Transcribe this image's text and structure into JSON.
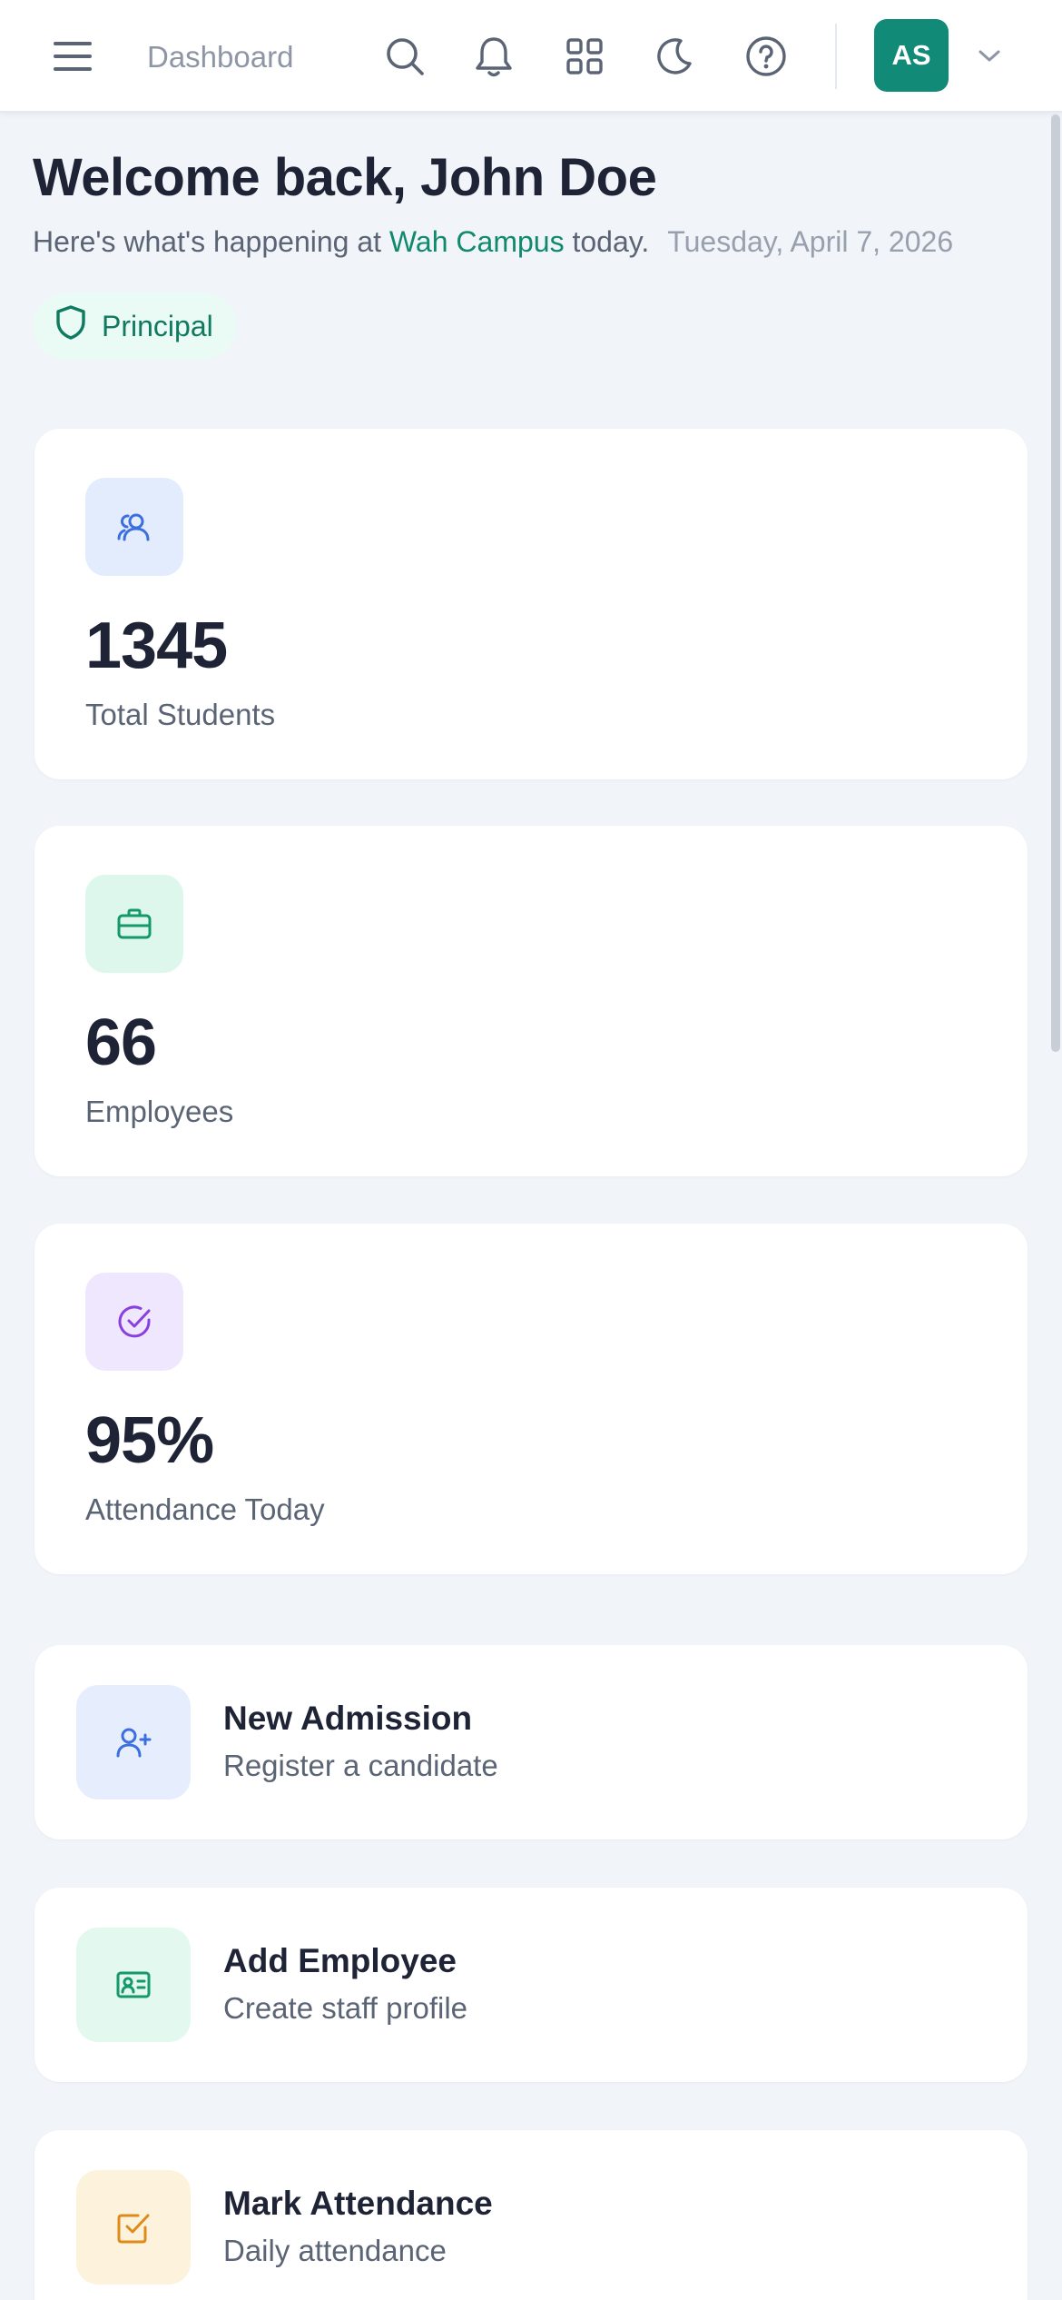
{
  "topbar": {
    "breadcrumb": "Dashboard",
    "avatar_initials": "AS",
    "icons": [
      "menu-icon",
      "search-icon",
      "bell-icon",
      "grid-icon",
      "moon-icon",
      "help-icon",
      "chevron-down-icon"
    ]
  },
  "header": {
    "welcome": "Welcome back, John Doe",
    "sub_prefix": "Here's what's happening at ",
    "campus": "Wah Campus",
    "sub_suffix": " today.",
    "date": "Tuesday, April 7, 2026",
    "role": "Principal"
  },
  "stats": [
    {
      "value": "1345",
      "label": "Total Students",
      "icon": "users-icon",
      "color": "#3b6fe0",
      "bg": "#e3ecfd"
    },
    {
      "value": "66",
      "label": "Employees",
      "icon": "briefcase-icon",
      "color": "#14996a",
      "bg": "#ddf7ec"
    },
    {
      "value": "95%",
      "label": "Attendance Today",
      "icon": "check-circle-icon",
      "color": "#8a3fe0",
      "bg": "#efe7fd"
    }
  ],
  "actions": [
    {
      "title": "New Admission",
      "subtitle": "Register a candidate",
      "icon": "user-plus-icon",
      "color": "#3b6fe0",
      "bg": "#e6eefd"
    },
    {
      "title": "Add Employee",
      "subtitle": "Create staff profile",
      "icon": "id-card-icon",
      "color": "#14996a",
      "bg": "#e3f8ee"
    },
    {
      "title": "Mark Attendance",
      "subtitle": "Daily attendance",
      "icon": "check-square-icon",
      "color": "#e08a1a",
      "bg": "#fdf3dc"
    }
  ],
  "colors": {
    "accent": "#128a78",
    "campus_text": "#0f8a6c",
    "background": "#f1f4f9"
  }
}
